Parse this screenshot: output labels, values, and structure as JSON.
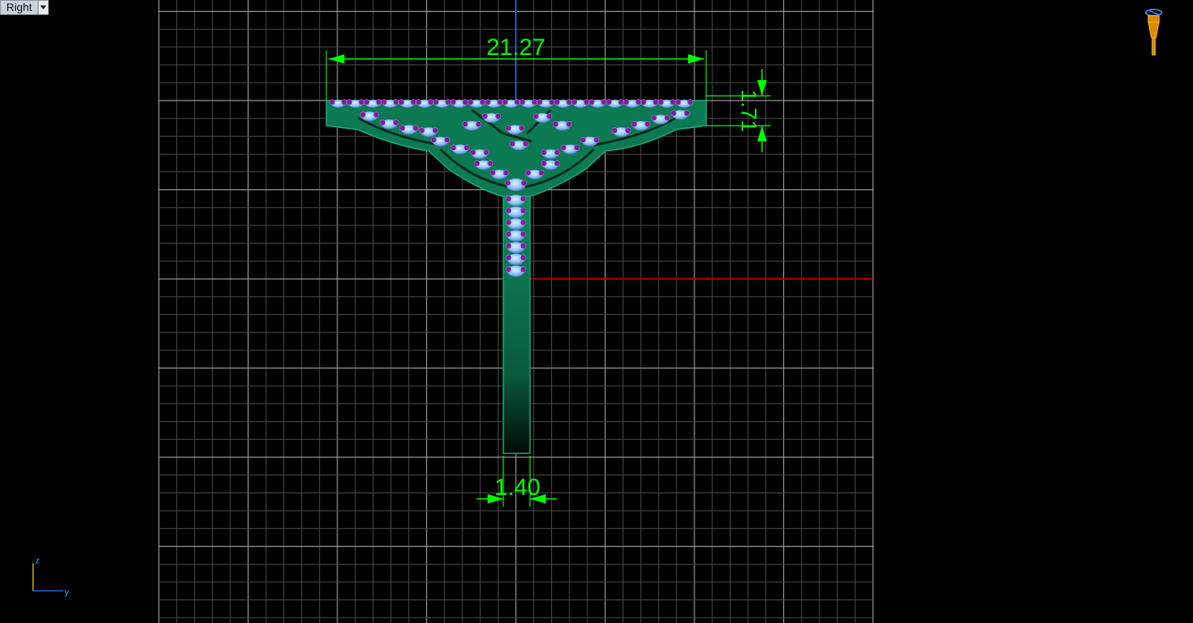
{
  "viewport": {
    "name": "Right",
    "dropdown_icon": "chevron-down-icon"
  },
  "dimensions": {
    "width": "21.27",
    "height": "1.71",
    "shank_width": "1.40"
  },
  "axis_indicator": {
    "vertical": "z",
    "horizontal": "y"
  },
  "colors": {
    "background": "#000000",
    "grid_minor": "#5a5a5a",
    "grid_major": "#9a9a9a",
    "dimension": "#00ff00",
    "metal": "#0a8a5c",
    "gem": "#8fc8f5",
    "prong": "#7a1f9a",
    "axis_x": "#b00000",
    "axis_y": "#1060c0"
  },
  "camera_icon": "camera-icon"
}
